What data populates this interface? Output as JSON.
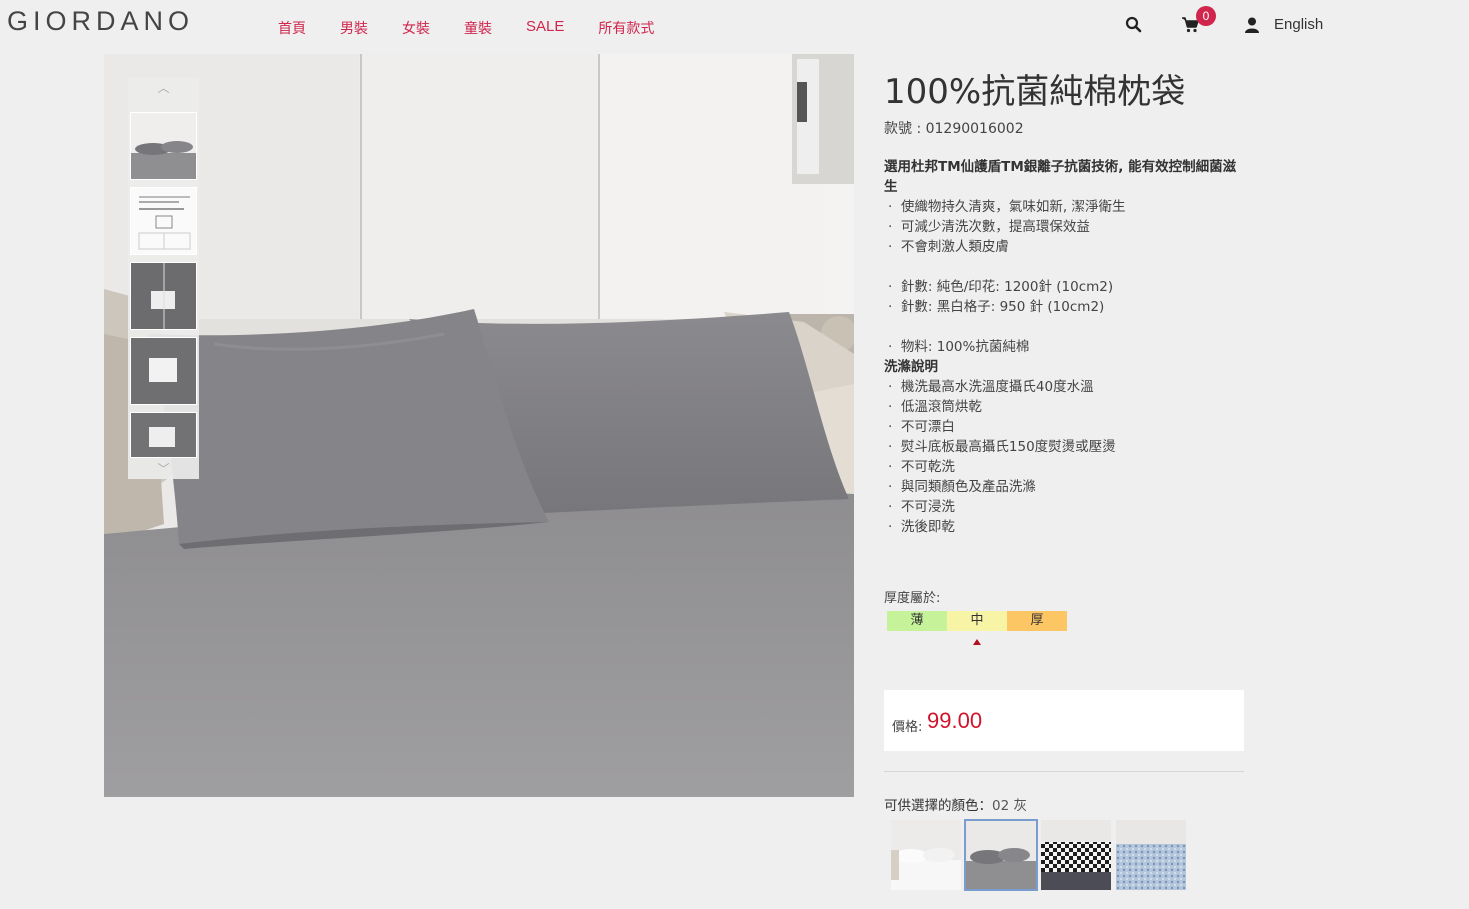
{
  "header": {
    "logo": "GIORDANO",
    "nav": [
      "首頁",
      "男裝",
      "女裝",
      "童裝",
      "SALE",
      "所有款式"
    ],
    "cart_count": "0",
    "language": "English"
  },
  "product": {
    "title": "100%抗菌純棉枕袋",
    "sku": "款號 : 01290016002",
    "lead_line1": "選用杜邦TM仙護盾TM銀離子抗菌技術, 能有效控制細菌滋",
    "lead_line2": "生",
    "features": [
      "使織物持久清爽，氣味如新, 潔淨衛生",
      "可減少清洗次數，提高環保效益",
      "不會刺激人類皮膚"
    ],
    "specs": [
      "針數: 純色/印花: 1200針 (10cm2)",
      "針數: 黑白格子: 950 針 (10cm2)"
    ],
    "material": "物料: 100%抗菌純棉",
    "care_title": "洗滌說明",
    "care": [
      "機洗最高水洗溫度攝氏40度水溫",
      "低溫滾筒烘乾",
      "不可漂白",
      "熨斗底板最高攝氏150度熨燙或壓燙",
      "不可乾洗",
      "與同類顏色及產品洗滌",
      "不可浸洗",
      "洗後即乾"
    ],
    "bullet": "·"
  },
  "thickness": {
    "label": "厚度屬於:",
    "levels": [
      "薄",
      "中",
      "厚"
    ],
    "colors": [
      "#c6f29a",
      "#f8f4a6",
      "#fcc664"
    ],
    "selected": "中"
  },
  "price": {
    "label": "價格:",
    "value": "99.00"
  },
  "colors": {
    "label": "可供選擇的顏色：",
    "selected": "02 灰",
    "swatches": [
      "white",
      "grey",
      "black-white-check",
      "blue-print"
    ]
  },
  "icons": {
    "search": "search-icon",
    "cart": "cart-icon",
    "user": "user-icon",
    "thumb_up": "chevron-up-icon",
    "thumb_down": "chevron-down-icon"
  },
  "accent": "#d0264d",
  "price_color": "#d0142c"
}
